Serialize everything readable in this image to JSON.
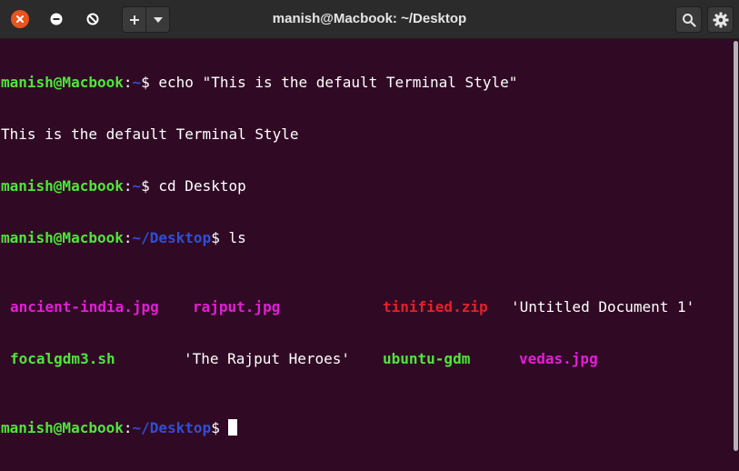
{
  "window": {
    "title": "manish@Macbook: ~/Desktop",
    "controls": [
      "close-icon",
      "minimize-icon",
      "maximize-icon"
    ],
    "new_tab_icon": "plus-icon",
    "tab_menu_icon": "chevron-down-icon",
    "search_icon": "search-icon",
    "menu_icon": "gear-icon"
  },
  "colors": {
    "background": "#300a24",
    "user_host": "#4ee63a",
    "path": "#2f4ed8",
    "image_file": "#e21ed6",
    "archive_file": "#e5202a",
    "executable": "#4ee63a"
  },
  "terminal": {
    "lines": [
      {
        "user": "manish@Macbook",
        "sep": ":",
        "path": "~",
        "prompt": "$ ",
        "command": "echo \"This is the default Terminal Style\""
      },
      {
        "output": "This is the default Terminal Style"
      },
      {
        "user": "manish@Macbook",
        "sep": ":",
        "path": "~",
        "prompt": "$ ",
        "command": "cd Desktop"
      },
      {
        "user": "manish@Macbook",
        "sep": ":",
        "path": "~/Desktop",
        "prompt": "$ ",
        "command": "ls"
      }
    ],
    "ls_row1": [
      "ancient-india.jpg",
      "rajput.jpg",
      "tinified.zip",
      "'Untitled Document 1'"
    ],
    "ls_row2": [
      "focalgdm3.sh",
      "'The Rajput Heroes'",
      "ubuntu-gdm",
      "vedas.jpg"
    ],
    "final_prompt": {
      "user": "manish@Macbook",
      "sep": ":",
      "path": "~/Desktop",
      "prompt": "$"
    }
  }
}
